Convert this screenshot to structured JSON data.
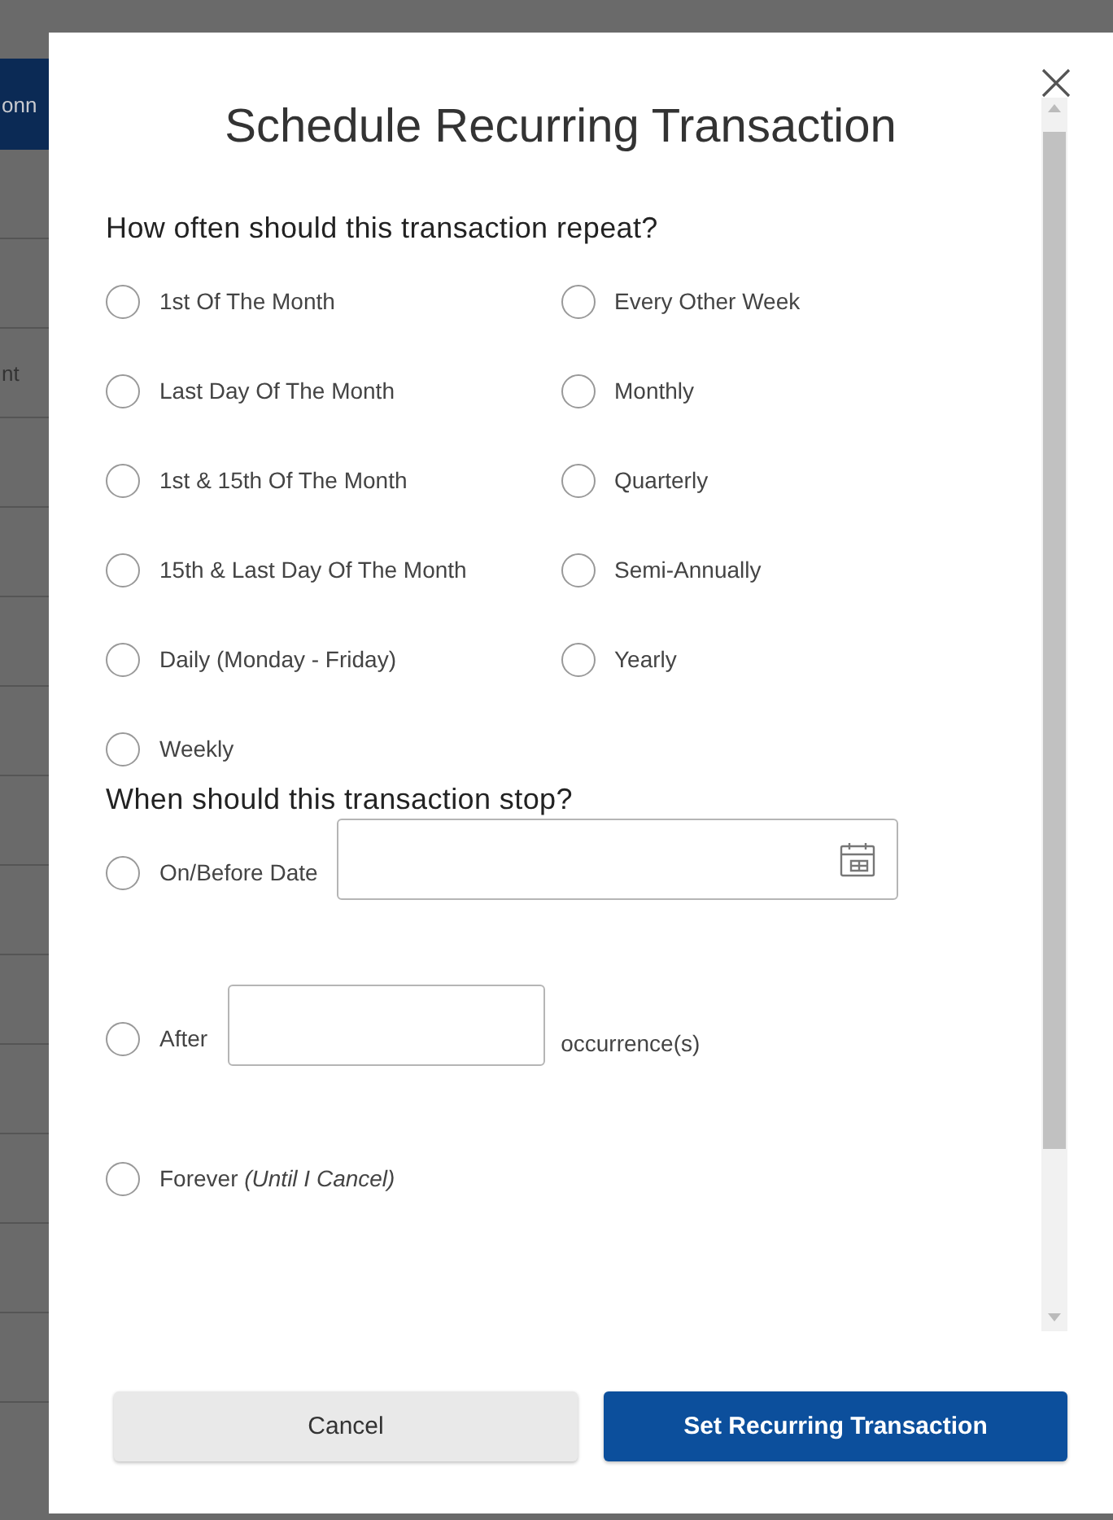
{
  "background": {
    "banner_text": "onn",
    "row_text": "nt"
  },
  "dialog": {
    "title": "Schedule Recurring Transaction",
    "frequency": {
      "heading": "How often should this transaction repeat?",
      "columns": [
        [
          {
            "label": "1st Of The Month",
            "selected": false
          },
          {
            "label": "Last Day Of The Month",
            "selected": false
          },
          {
            "label": "1st & 15th Of The Month",
            "selected": false
          },
          {
            "label": "15th & Last Day Of The Month",
            "selected": false
          },
          {
            "label": "Daily (Monday - Friday)",
            "selected": false
          },
          {
            "label": "Weekly",
            "selected": false
          }
        ],
        [
          {
            "label": "Every Other Week",
            "selected": false
          },
          {
            "label": "Monthly",
            "selected": false
          },
          {
            "label": "Quarterly",
            "selected": false
          },
          {
            "label": "Semi-Annually",
            "selected": false
          },
          {
            "label": "Yearly",
            "selected": false
          }
        ]
      ]
    },
    "stop": {
      "heading": "When should this transaction stop?",
      "options": [
        {
          "kind": "date",
          "label": "On/Before Date",
          "selected": false
        },
        {
          "kind": "count",
          "label": "After",
          "suffix": "occurrence(s)",
          "selected": false
        },
        {
          "kind": "plain",
          "label": "Forever *(Until I Cancel)*",
          "selected": false
        }
      ]
    },
    "buttons": [
      {
        "kind": "secondary",
        "label": "Cancel"
      },
      {
        "kind": "primary",
        "label": "Set Recurring Transaction"
      }
    ]
  }
}
